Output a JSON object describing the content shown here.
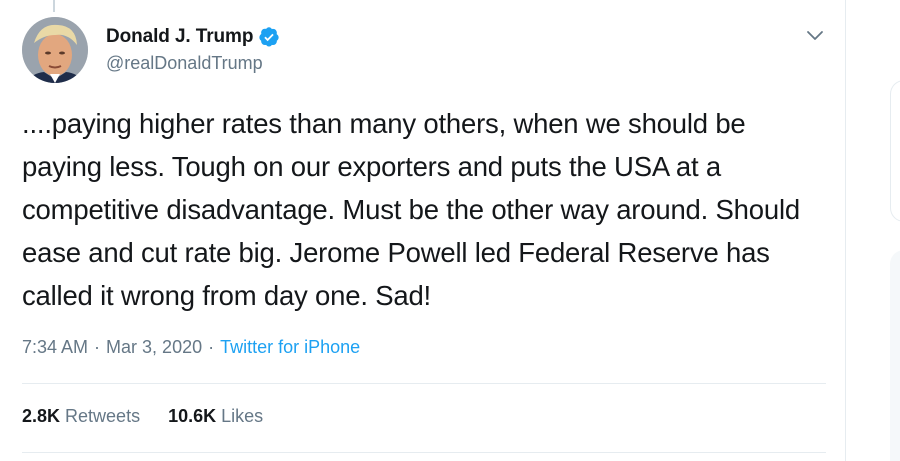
{
  "author": {
    "display_name": "Donald J. Trump",
    "handle": "@realDonaldTrump",
    "verified": true,
    "avatar_icon": "profile-photo",
    "verified_color": "#1da1f2"
  },
  "tweet": {
    "text": "....paying higher rates than many others, when we should be paying less. Tough on our exporters and puts the USA at a competitive disadvantage. Must be the other way around. Should ease and cut rate big. Jerome Powell led Federal Reserve has called it wrong from day one. Sad!",
    "time": "7:34 AM",
    "date": "Mar 3, 2020",
    "separator": "·",
    "source": "Twitter for iPhone"
  },
  "stats": {
    "retweets_count": "2.8K",
    "retweets_label": "Retweets",
    "likes_count": "10.6K",
    "likes_label": "Likes"
  },
  "colors": {
    "text": "#14171a",
    "secondary": "#657786",
    "accent": "#1da1f2",
    "border": "#e6ecf0"
  }
}
